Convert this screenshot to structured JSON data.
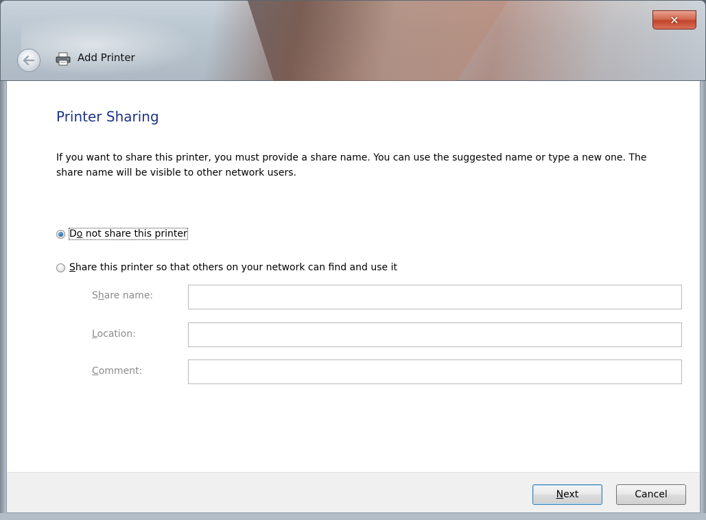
{
  "window": {
    "title": "Add Printer",
    "close_glyph": "✕",
    "back_icon": "back-arrow-icon",
    "title_icon": "printer-icon"
  },
  "content": {
    "heading": "Printer Sharing",
    "description": "If you want to share this printer, you must provide a share name. You can use the suggested name or type a new one. The share name will be visible to other network users.",
    "options": [
      {
        "pre": "D",
        "accel": "o",
        "post": " not share this printer",
        "checked": true
      },
      {
        "pre": "",
        "accel": "S",
        "post": "hare this printer so that others on your network can find and use it",
        "checked": false
      }
    ],
    "fields": [
      {
        "pre": "S",
        "accel": "h",
        "post": "are name:",
        "value": ""
      },
      {
        "pre": "",
        "accel": "L",
        "post": "ocation:",
        "value": ""
      },
      {
        "pre": "",
        "accel": "C",
        "post": "omment:",
        "value": ""
      }
    ]
  },
  "footer": {
    "next_pre": "",
    "next_accel": "N",
    "next_post": "ext",
    "cancel_label": "Cancel"
  },
  "colors": {
    "heading": "#1e3287",
    "close_button": "#c2442a",
    "footer_bg": "#f0f0f0"
  }
}
